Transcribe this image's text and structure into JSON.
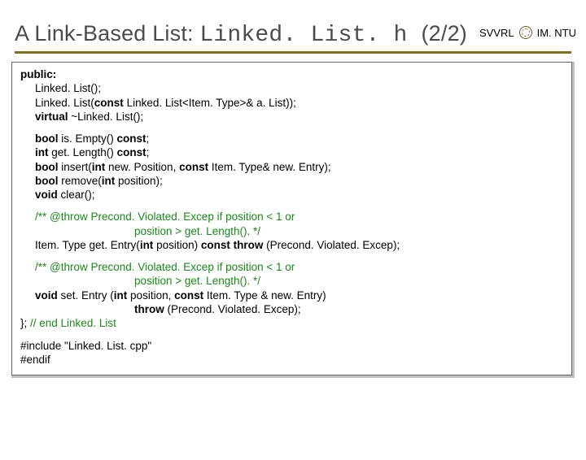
{
  "header": {
    "lab": "SVVRL",
    "institution": "IM. NTU"
  },
  "title": {
    "prefix": "A Link-Based List: ",
    "mono": "Linked. List. h ",
    "suffix": "(2/2)"
  },
  "code": {
    "l0": "public:",
    "l1a": "Linked. List();",
    "l2a": "Linked. List(",
    "l2b": "const",
    "l2c": " Linked. List<Item. Type>& a. List));",
    "l3a": "virtual",
    "l3b": " ~Linked. List();",
    "l4a": "bool",
    "l4b": " is. Empty() ",
    "l4c": "const",
    "l4d": ";",
    "l5a": "int",
    "l5b": " get. Length() ",
    "l5c": "const",
    "l5d": ";",
    "l6a": "bool",
    "l6b": " insert(",
    "l6c": "int",
    "l6d": " new. Position, ",
    "l6e": "const",
    "l6f": " Item. Type& new. Entry);",
    "l7a": "bool",
    "l7b": " remove(",
    "l7c": "int",
    "l7d": " position);",
    "l8a": "void",
    "l8b": " clear();",
    "c1": "/** @throw Precond. Violated. Excep if position < 1 or",
    "c2": "position > get. Length(). */",
    "l9a": "Item. Type get. Entry(",
    "l9b": "int",
    "l9c": " position) ",
    "l9d": "const throw",
    "l9e": " (Precond. Violated. Excep);",
    "c3": "/** @throw Precond. Violated. Excep if position < 1 or",
    "c4": "position > get. Length(). */",
    "l10a": "void",
    "l10b": " set. Entry (",
    "l10c": "int",
    "l10d": " position, ",
    "l10e": "const",
    "l10f": " Item. Type & new. Entry)",
    "l11a": "throw",
    "l11b": " (Precond. Violated. Excep);",
    "l12a": "}; ",
    "l12b": "// end Linked. List",
    "l13": "#include \"Linked. List. cpp\"",
    "l14": "#endif"
  }
}
